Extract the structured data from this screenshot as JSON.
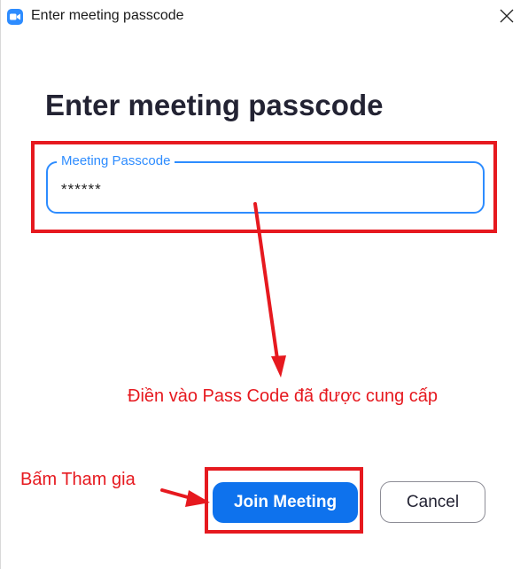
{
  "window": {
    "title": "Enter meeting passcode",
    "app_icon": "zoom-camera-icon",
    "close_icon": "close-icon"
  },
  "dialog": {
    "heading": "Enter meeting passcode",
    "passcode_field": {
      "label": "Meeting Passcode",
      "value": "******"
    },
    "join_button_label": "Join Meeting",
    "cancel_button_label": "Cancel"
  },
  "annotations": {
    "passcode_note": "Điền vào Pass Code đã được cung cấp",
    "join_note": "Bấm Tham gia",
    "color": "#e6191f"
  },
  "colors": {
    "accent": "#2d8cff",
    "primary_button": "#0e72ed",
    "heading": "#232333"
  }
}
